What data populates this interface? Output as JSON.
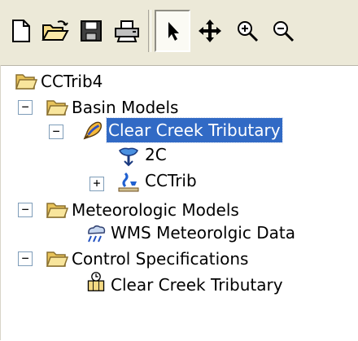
{
  "toolbar": {
    "buttons": [
      {
        "icon": "new-file-icon"
      },
      {
        "icon": "open-folder-icon"
      },
      {
        "icon": "save-icon"
      },
      {
        "icon": "print-icon"
      },
      {
        "icon": "select-arrow-icon",
        "pressed": true
      },
      {
        "icon": "pan-icon"
      },
      {
        "icon": "zoom-in-icon"
      },
      {
        "icon": "zoom-out-icon"
      }
    ]
  },
  "tree": {
    "root": {
      "label": "CCTrib4",
      "icon": "folder-open-icon"
    },
    "basin_models": {
      "label": "Basin Models",
      "expander": "−",
      "icon": "folder-open-icon"
    },
    "clear_creek_basin": {
      "label": "Clear Creek Tributary",
      "expander": "−",
      "icon": "basin-model-icon",
      "selected": true
    },
    "subbasin_2c": {
      "label": "2C",
      "icon": "subbasin-icon"
    },
    "cctrib": {
      "label": "CCTrib",
      "expander": "+",
      "icon": "reach-icon"
    },
    "met_models": {
      "label": "Meteorologic Models",
      "expander": "−",
      "icon": "folder-open-icon"
    },
    "wms_met": {
      "label": "WMS Meteorolgic Data",
      "icon": "meteorologic-icon"
    },
    "control_specs": {
      "label": "Control Specifications",
      "expander": "−",
      "icon": "folder-open-icon"
    },
    "control_clear_creek": {
      "label": "Clear Creek Tributary",
      "icon": "calendar-clock-icon"
    }
  },
  "colors": {
    "selection": "#316ac5",
    "toolbar_bg": "#ece9d8",
    "folder": "#f4d983"
  }
}
